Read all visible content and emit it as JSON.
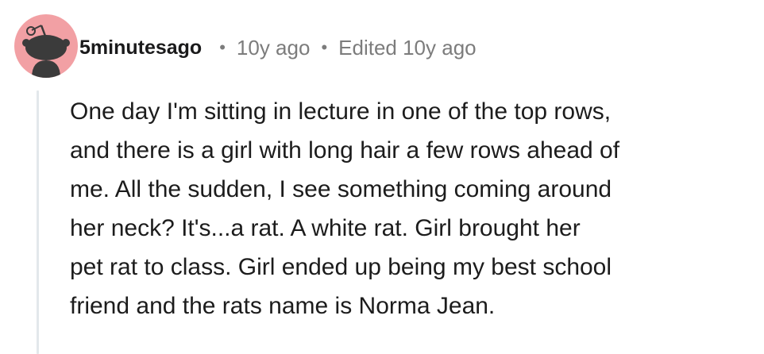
{
  "comment": {
    "author": "5minutesago",
    "separator": "•",
    "posted": "10y ago",
    "edited": "Edited 10y ago",
    "avatar_icon": "reddit-snoo-avatar-icon",
    "body_lines": [
      "One day I'm sitting in lecture in one of the top rows,",
      "and there is a girl with long hair a few rows ahead of",
      "me. All the sudden, I see something coming around",
      "her neck? It's...a rat. A white rat. Girl brought her",
      "pet rat to class. Girl ended up being my best school",
      "friend and the rats name is Norma Jean."
    ]
  },
  "colors": {
    "avatar_bg": "#f2a0a4",
    "avatar_figure": "#3b3b3b",
    "meta_text": "#7c7c7c",
    "thread_line": "#e3e8eb"
  }
}
